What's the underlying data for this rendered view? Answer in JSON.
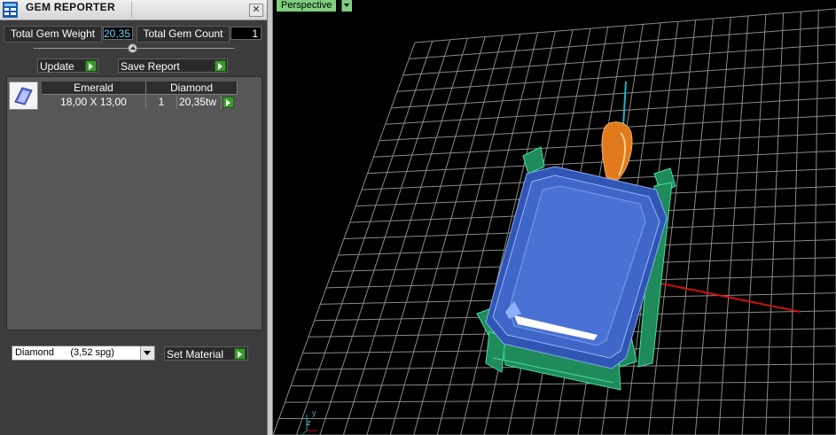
{
  "window": {
    "title": "GEM REPORTER",
    "close_glyph": "✕"
  },
  "summary": {
    "weight_label": "Total Gem Weight",
    "weight_value": "20,35",
    "count_label": "Total Gem Count",
    "count_value": "1"
  },
  "toolbar": {
    "update_label": "Update",
    "save_label": "Save Report"
  },
  "gem_table": {
    "headers": [
      "Emerald",
      "Diamond"
    ],
    "row": {
      "size": "18,00 X 13,00",
      "count": "1",
      "weight": "20,35tw"
    }
  },
  "material": {
    "selected": "Diamond      (3,52 spg)",
    "set_label": "Set Material"
  },
  "viewport": {
    "label": "Perspective",
    "axis_y": "y",
    "axis_z": "z",
    "colors": {
      "grid": "#8a8a8a",
      "gem": "#3f66c9",
      "prongs": "#1f8a5a",
      "bail": "#e07a1c",
      "axis_x": "#d01010",
      "axis_y": "#19b5c8"
    }
  },
  "icons": [
    "app-icon",
    "close-icon",
    "slider-knob-icon",
    "play-icon",
    "gem-thumbnail-icon",
    "dropdown-arrow-icon"
  ]
}
